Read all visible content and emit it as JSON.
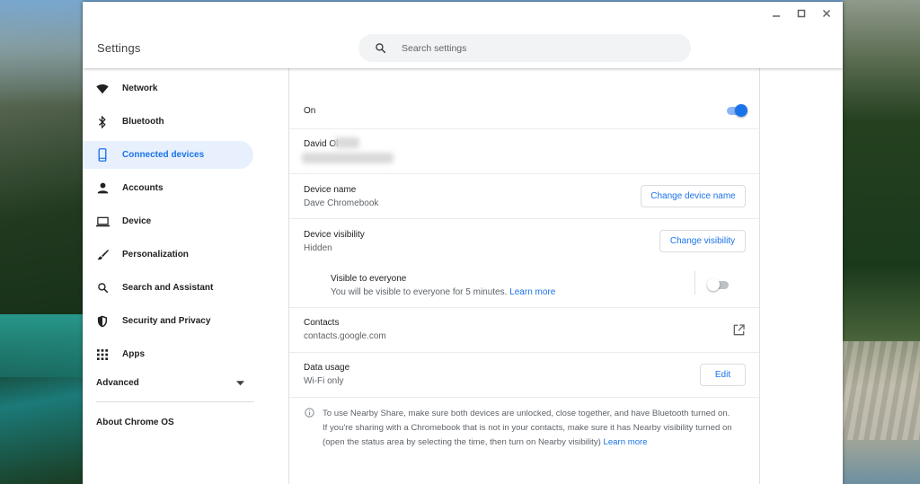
{
  "window": {
    "title": "Settings",
    "controls": {
      "minimize": "–",
      "maximize": "□",
      "close": "✕"
    }
  },
  "search": {
    "placeholder": "Search settings"
  },
  "sidebar": {
    "items": [
      {
        "label": "Network",
        "icon": "wifi-icon"
      },
      {
        "label": "Bluetooth",
        "icon": "bluetooth-icon"
      },
      {
        "label": "Connected devices",
        "icon": "phone-icon",
        "active": true
      },
      {
        "label": "Accounts",
        "icon": "person-icon"
      },
      {
        "label": "Device",
        "icon": "laptop-icon"
      },
      {
        "label": "Personalization",
        "icon": "brush-icon"
      },
      {
        "label": "Search and Assistant",
        "icon": "search-icon"
      },
      {
        "label": "Security and Privacy",
        "icon": "shield-icon"
      },
      {
        "label": "Apps",
        "icon": "apps-grid-icon"
      }
    ],
    "advanced": "Advanced",
    "about": "About Chrome OS"
  },
  "nearby": {
    "status": "On",
    "enabled": true,
    "account_name": "David Ol",
    "device_name": {
      "label": "Device name",
      "value": "Dave Chromebook",
      "button": "Change device name"
    },
    "visibility": {
      "label": "Device visibility",
      "value": "Hidden",
      "button": "Change visibility",
      "everyone": {
        "label": "Visible to everyone",
        "description": "You will be visible to everyone for 5 minutes.",
        "link": "Learn more",
        "enabled": false
      }
    },
    "contacts": {
      "label": "Contacts",
      "value": "contacts.google.com"
    },
    "data_usage": {
      "label": "Data usage",
      "value": "Wi-Fi only",
      "button": "Edit"
    },
    "info": {
      "text": "To use Nearby Share, make sure both devices are unlocked, close together, and have Bluetooth turned on. If you're sharing with a Chromebook that is not in your contacts, make sure it has Nearby visibility turned on (open the status area by selecting the time, then turn on Nearby visibility)",
      "link": "Learn more"
    }
  },
  "colors": {
    "accent": "#1a73e8",
    "active_bg": "#e8f0fe",
    "text": "#202124",
    "secondary_text": "#5f6368"
  }
}
